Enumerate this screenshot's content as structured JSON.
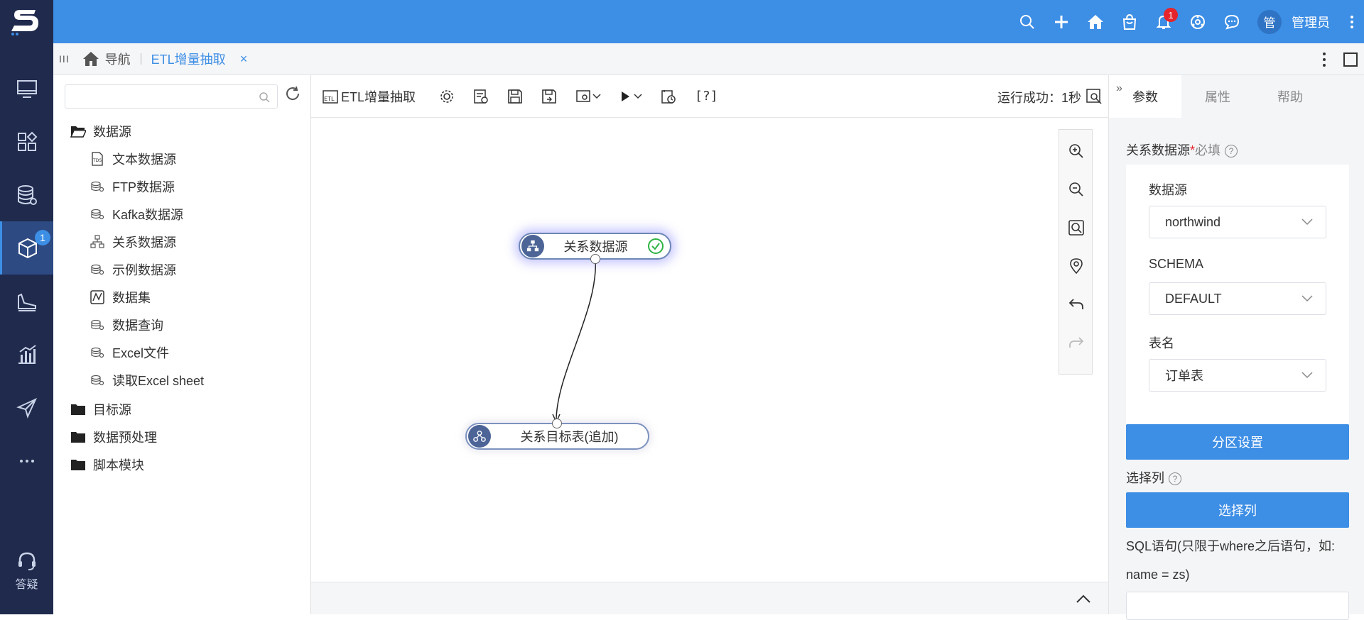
{
  "topbar": {
    "notification_badge": "1",
    "avatar_text": "管",
    "username": "管理员"
  },
  "leftnav": {
    "items": [
      "desktop-icon",
      "modules-icon",
      "datasource-icon",
      "cube-icon",
      "analysis-icon",
      "chart-icon",
      "publish-icon",
      "more-icon"
    ],
    "active_badge": "1",
    "help_label": "答疑"
  },
  "tabbar": {
    "menu_glyph": "III",
    "home_label": "导航",
    "active_tab": "ETL增量抽取",
    "close_glyph": "×"
  },
  "tree": {
    "search_placeholder": "",
    "folders": [
      {
        "label": "数据源",
        "children": [
          "文本数据源",
          "FTP数据源",
          "Kafka数据源",
          "关系数据源",
          "示例数据源",
          "数据集",
          "数据查询",
          "Excel文件",
          "读取Excel sheet"
        ]
      },
      {
        "label": "目标源"
      },
      {
        "label": "数据预处理"
      },
      {
        "label": "脚本模块"
      }
    ]
  },
  "toolbar": {
    "title": "ETL增量抽取",
    "help_text": "[?]",
    "status": "运行成功：1秒"
  },
  "canvas": {
    "source_node": "关系数据源",
    "target_node": "关系目标表(追加)"
  },
  "rightpanel": {
    "tabs": [
      "参数",
      "属性",
      "帮助"
    ],
    "collapse_glyph": "»",
    "section_label": "关系数据源",
    "required_mark": "*",
    "required_text": "必填",
    "help_glyph": "?",
    "datasource_label": "数据源",
    "datasource_value": "northwind",
    "schema_label": "SCHEMA",
    "schema_value": "DEFAULT",
    "table_label": "表名",
    "table_value": "订单表",
    "partition_button": "分区设置",
    "columns_label": "选择列",
    "columns_button": "选择列",
    "sql_label_line1": "SQL语句(只限于where之后语句，如:",
    "sql_label_line2": "name = zs)"
  },
  "colors": {
    "topbar": "#3d8ee5",
    "leftnav": "#1f2a4d",
    "accent": "#3d8ee5",
    "badge": "#e5242b"
  }
}
